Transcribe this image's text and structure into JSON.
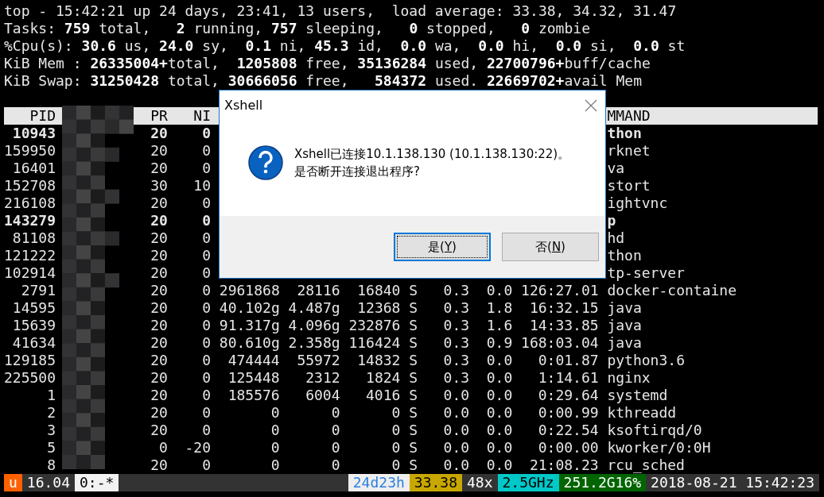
{
  "summary": [
    "top - 15:42:21 up 24 days, 23:41, 13 users,  load average: 33.38, 34.32, 31.47",
    "Tasks: **759** total,   **2** running, **757** sleeping,   **0** stopped,   **0** zombie",
    "%Cpu(s): **30.6** us, **24.0** sy,  **0.1** ni, **45.3** id,  **0.0** wa,  **0.0** hi,  **0.0** si,  **0.0** st",
    "KiB Mem : **26335004+**total,  **1205808** free, **35136284** used, **22700796+**buff/cache",
    "KiB Swap: **31250428** total, **30666056** free,   **584372** used. **22669702+**avail Mem"
  ],
  "header": {
    "pid": "PID",
    "pr": "PR",
    "ni": "NI",
    "command": "MMAND"
  },
  "rows": [
    {
      "pid": "10943",
      "pr": "20",
      "ni": "0",
      "command": "thon",
      "running": true
    },
    {
      "pid": "159950",
      "pr": "20",
      "ni": "0",
      "command": "rknet",
      "running": false
    },
    {
      "pid": "16401",
      "pr": "20",
      "ni": "0",
      "command": "va",
      "running": false
    },
    {
      "pid": "152708",
      "pr": "30",
      "ni": "10",
      "command": "stort",
      "running": false
    },
    {
      "pid": "216108",
      "pr": "20",
      "ni": "0",
      "command": "ightvnc",
      "running": false
    },
    {
      "pid": "143279",
      "pr": "20",
      "ni": "0",
      "command": "p",
      "running": true
    },
    {
      "pid": "81108",
      "pr": "20",
      "ni": "0",
      "command": "hd",
      "running": false
    },
    {
      "pid": "121222",
      "pr": "20",
      "ni": "0",
      "command": "thon",
      "running": false
    },
    {
      "pid": "102914",
      "pr": "20",
      "ni": "0",
      "command": "tp-server",
      "running": false
    },
    {
      "pid": "2791",
      "pr": "20",
      "ni": "0",
      "virt": "2961868",
      "res": "28116",
      "shr": "16840",
      "s": "S",
      "cpu": "0.3",
      "mem": "0.0",
      "time": "126:27.01",
      "command": "docker-containe",
      "running": false
    },
    {
      "pid": "14595",
      "pr": "20",
      "ni": "0",
      "virt": "40.102g",
      "res": "4.487g",
      "shr": "12368",
      "s": "S",
      "cpu": "0.3",
      "mem": "1.8",
      "time": "16:32.15",
      "command": "java",
      "running": false
    },
    {
      "pid": "15639",
      "pr": "20",
      "ni": "0",
      "virt": "91.317g",
      "res": "4.096g",
      "shr": "232876",
      "s": "S",
      "cpu": "0.3",
      "mem": "1.6",
      "time": "14:33.85",
      "command": "java",
      "running": false
    },
    {
      "pid": "41634",
      "pr": "20",
      "ni": "0",
      "virt": "80.610g",
      "res": "2.358g",
      "shr": "116424",
      "s": "S",
      "cpu": "0.3",
      "mem": "0.9",
      "time": "168:03.04",
      "command": "java",
      "running": false
    },
    {
      "pid": "129185",
      "pr": "20",
      "ni": "0",
      "virt": "474444",
      "res": "55972",
      "shr": "14832",
      "s": "S",
      "cpu": "0.3",
      "mem": "0.0",
      "time": "0:01.87",
      "command": "python3.6",
      "running": false
    },
    {
      "pid": "225500",
      "pr": "20",
      "ni": "0",
      "virt": "125448",
      "res": "2312",
      "shr": "1824",
      "s": "S",
      "cpu": "0.3",
      "mem": "0.0",
      "time": "1:14.61",
      "command": "nginx",
      "running": false
    },
    {
      "pid": "1",
      "pr": "20",
      "ni": "0",
      "virt": "185576",
      "res": "6004",
      "shr": "4016",
      "s": "S",
      "cpu": "0.0",
      "mem": "0.0",
      "time": "0:29.64",
      "command": "systemd",
      "running": false
    },
    {
      "pid": "2",
      "pr": "20",
      "ni": "0",
      "virt": "0",
      "res": "0",
      "shr": "0",
      "s": "S",
      "cpu": "0.0",
      "mem": "0.0",
      "time": "0:00.99",
      "command": "kthreadd",
      "running": false
    },
    {
      "pid": "3",
      "pr": "20",
      "ni": "0",
      "virt": "0",
      "res": "0",
      "shr": "0",
      "s": "S",
      "cpu": "0.0",
      "mem": "0.0",
      "time": "0:22.54",
      "command": "ksoftirqd/0",
      "running": false
    },
    {
      "pid": "5",
      "pr": "0",
      "ni": "-20",
      "virt": "0",
      "res": "0",
      "shr": "0",
      "s": "S",
      "cpu": "0.0",
      "mem": "0.0",
      "time": "0:00.00",
      "command": "kworker/0:0H",
      "running": false
    },
    {
      "pid": "8",
      "pr": "20",
      "ni": "0",
      "virt": "0",
      "res": "0",
      "shr": "0",
      "s": "S",
      "cpu": "0.0",
      "mem": "0.0",
      "time": "21:08.23",
      "command": "rcu_sched",
      "running": false
    }
  ],
  "status_bar": {
    "left": [
      {
        "text": "u",
        "color": "#ff6000"
      },
      {
        "text": "16.04",
        "color": "#333333"
      },
      {
        "text": "0:-*",
        "color": "#f2f2f2"
      }
    ],
    "right": [
      {
        "text": "24d23h",
        "color": "#eeeeee"
      },
      {
        "text": "33.38",
        "color": "#c8a800"
      },
      {
        "text": "48x",
        "color": "#333333"
      },
      {
        "text": "2.5GHz",
        "color": "#00c8c8"
      },
      {
        "text": "251.2G16%",
        "color": "#006400"
      },
      {
        "text": "2018-08-21 15:42:23",
        "color": "#333333"
      }
    ]
  },
  "dialog": {
    "title": "Xshell",
    "message": [
      "Xshell已连接10.1.138.130 (10.1.138.130:22)。",
      "是否断开连接退出程序?"
    ],
    "buttons": [
      {
        "prefix": "是(",
        "accesskey": "Y",
        "suffix": ")",
        "focused": true
      },
      {
        "prefix": "否(",
        "accesskey": "N",
        "suffix": ")",
        "focused": false
      }
    ]
  }
}
